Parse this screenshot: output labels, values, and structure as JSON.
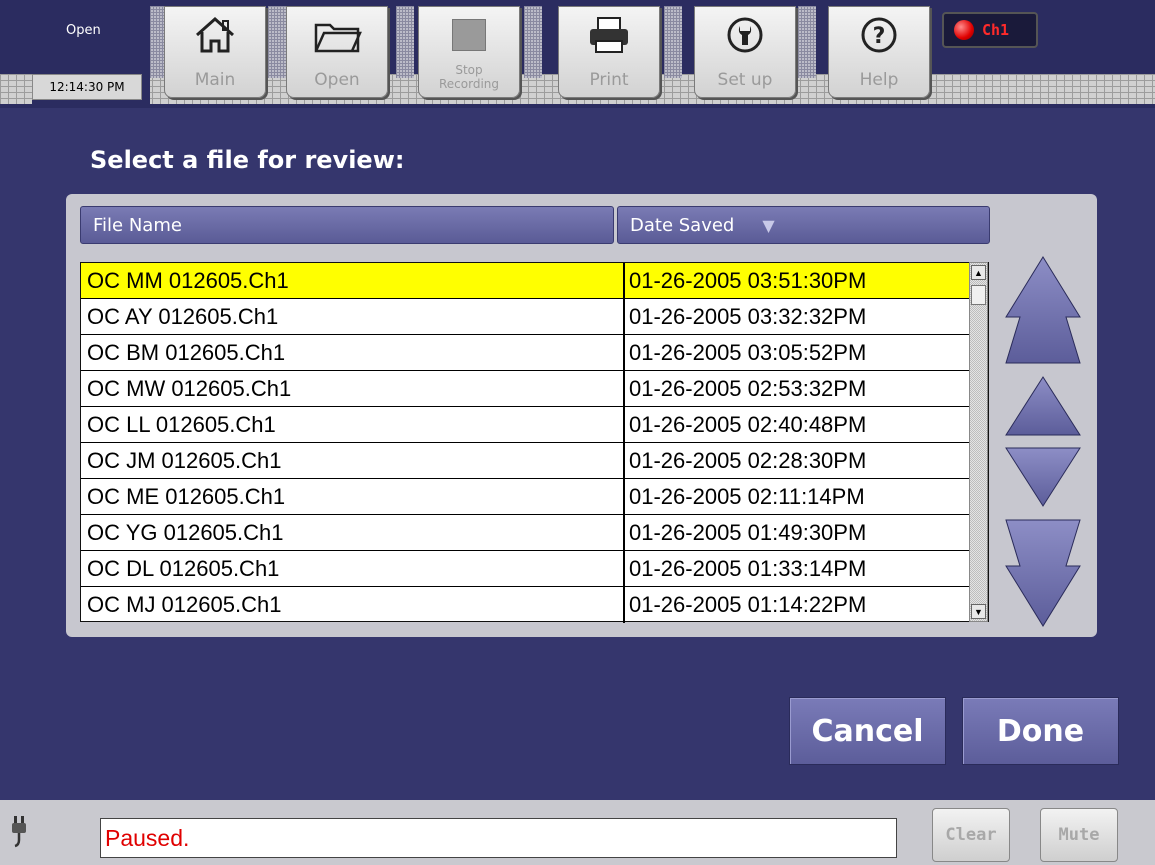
{
  "top": {
    "mode_label": "Open",
    "clock": "12:14:30 PM",
    "channel_label": "Ch1"
  },
  "toolbar": {
    "main_label": "Main",
    "open_label": "Open",
    "stop_label_1": "Stop",
    "stop_label_2": "Recording",
    "print_label": "Print",
    "setup_label": "Set up",
    "help_label": "Help"
  },
  "title": "Select a file for review:",
  "table": {
    "col_file": "File Name",
    "col_date": "Date Saved",
    "sort_icon": "▼",
    "rows": [
      {
        "name": "OC MM 012605.Ch1",
        "date": "01-26-2005 03:51:30PM",
        "selected": true
      },
      {
        "name": "OC AY 012605.Ch1",
        "date": "01-26-2005 03:32:32PM"
      },
      {
        "name": "OC BM 012605.Ch1",
        "date": "01-26-2005 03:05:52PM"
      },
      {
        "name": "OC MW 012605.Ch1",
        "date": "01-26-2005 02:53:32PM"
      },
      {
        "name": "OC LL 012605.Ch1",
        "date": "01-26-2005 02:40:48PM"
      },
      {
        "name": "OC JM 012605.Ch1",
        "date": "01-26-2005 02:28:30PM"
      },
      {
        "name": "OC ME 012605.Ch1",
        "date": "01-26-2005 02:11:14PM"
      },
      {
        "name": "OC YG 012605.Ch1",
        "date": "01-26-2005 01:49:30PM"
      },
      {
        "name": "OC DL 012605.Ch1",
        "date": "01-26-2005 01:33:14PM"
      },
      {
        "name": "OC MJ 012605.Ch1",
        "date": "01-26-2005 01:14:22PM"
      }
    ]
  },
  "actions": {
    "cancel": "Cancel",
    "done": "Done"
  },
  "status": {
    "message": "Paused.",
    "clear": "Clear",
    "mute": "Mute"
  },
  "colors": {
    "background": "#35366d",
    "accent": "#5c5d9a",
    "selection": "#ffff00",
    "status_text": "#e00000"
  }
}
